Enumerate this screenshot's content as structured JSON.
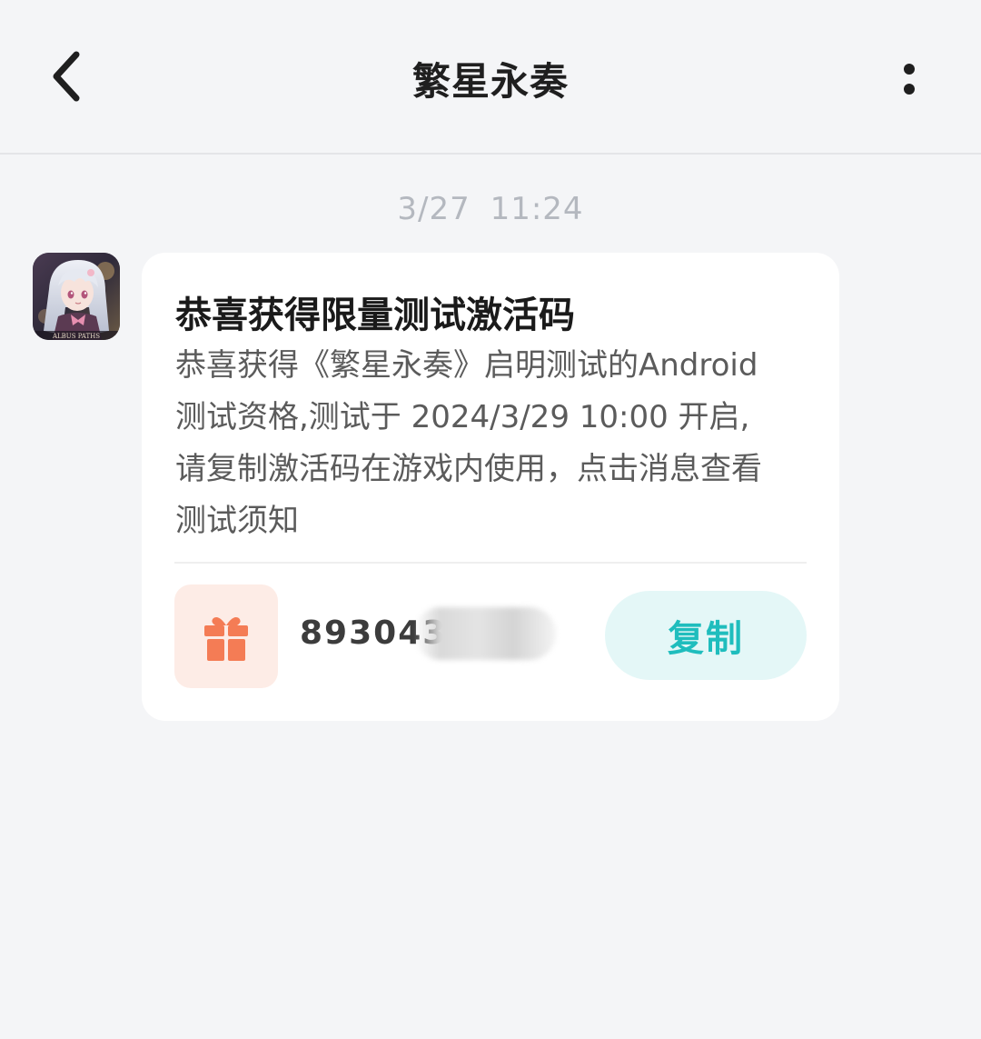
{
  "header": {
    "title": "繁星永奏"
  },
  "timestamp": "3/27  11:24",
  "message": {
    "avatar_label": "ALBUS PATHS",
    "title": "恭喜获得限量测试激活码",
    "body_lines": [
      "恭喜获得《繁星永奏》启明测试的Android",
      "测试资格,测试于 2024/3/29 10:00 开启,",
      "请复制激活码在游戏内使用，点击消息查看",
      "测试须知"
    ],
    "code_visible": "893043",
    "copy_label": "复制"
  },
  "colors": {
    "accent": "#1fbdbd",
    "gift": "#f47c55",
    "gift_bg": "#fdece6",
    "page_bg": "#f4f5f7"
  },
  "icons": {
    "back": "chevron-left-icon",
    "more": "more-vertical-icon",
    "gift": "gift-icon"
  }
}
